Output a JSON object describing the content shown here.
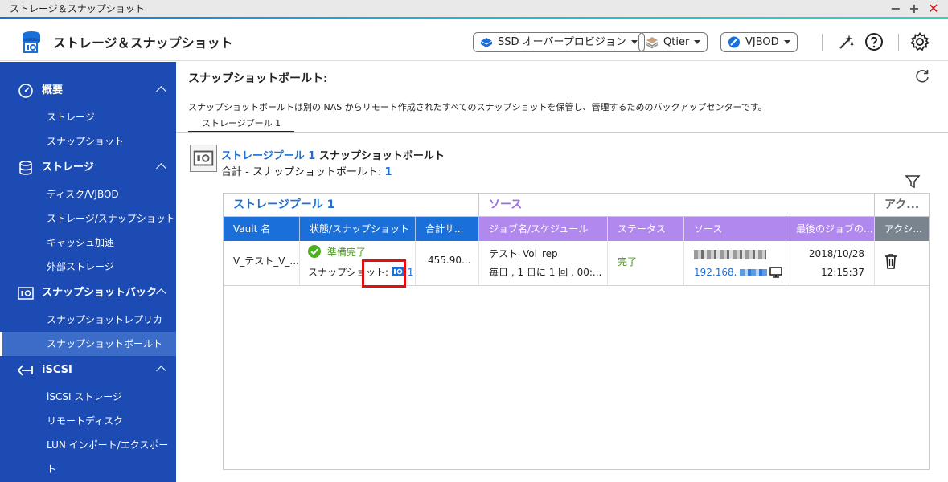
{
  "window": {
    "title": "ストレージ＆スナップショット",
    "minimize": "−",
    "maximize": "+",
    "close": "✕"
  },
  "header": {
    "app_title": "ストレージ＆スナップショット",
    "ssd_label": "SSD オーバープロビジョン",
    "qtier_label": "Qtier",
    "vjbod_label": "VJBOD",
    "icons": [
      "magic-wand-icon",
      "help-icon",
      "gear-icon"
    ]
  },
  "sidebar": {
    "groups": [
      {
        "label": "概要",
        "icon": "gauge-icon",
        "items": [
          "ストレージ",
          "スナップショット"
        ]
      },
      {
        "label": "ストレージ",
        "icon": "database-icon",
        "items": [
          "ディスク/VJBOD",
          "ストレージ/スナップショット",
          "キャッシュ加速",
          "外部ストレージ"
        ]
      },
      {
        "label": "スナップショットバックアップ",
        "icon": "snapshot-icon",
        "items": [
          "スナップショットレプリカ",
          "スナップショットボールト"
        ]
      },
      {
        "label": "iSCSI",
        "icon": "iscsi-icon",
        "items": [
          "iSCSI ストレージ",
          "リモートディスク",
          "LUN インポート/エクスポート"
        ]
      }
    ],
    "active_item": "スナップショットボールト"
  },
  "main": {
    "page_title": "スナップショットボールト:",
    "description": "スナップショットボールトは別の NAS からリモート作成されたすべてのスナップショットを保管し、管理するためのバックアップセンターです。",
    "tab": "ストレージプール 1",
    "vault_pool": "ストレージプール 1",
    "vault_suffix": " スナップショットボールト",
    "vault_total_label": "合計 - スナップショットボールト: ",
    "vault_total": "1"
  },
  "table": {
    "groups": [
      {
        "label": "ストレージプール 1"
      },
      {
        "label": "ソース"
      },
      {
        "label": "アク..."
      }
    ],
    "columns": [
      "Vault 名",
      "状態/スナップショット",
      "合計サ...",
      "ジョブ名/スケジュール",
      "ステータス",
      "ソース",
      "最後のジョブの...",
      "アクシ..."
    ],
    "rows": [
      {
        "vault_name": "V_テスト_V_...",
        "state": "準備完了",
        "snapshot_label": "スナップショット: ",
        "snapshot_count": "1",
        "total_size": "455.90...",
        "job_name": "テスト_Vol_rep",
        "schedule": "毎日 , 1 日に 1 回 , 00:...",
        "status": "完了",
        "source_ip": "192.168.",
        "last_date": "2018/10/28",
        "last_time": "12:15:37"
      }
    ]
  },
  "colors": {
    "sidebar": "#1c4cb3",
    "accent": "#1a6fd8",
    "purple": "#b088ee",
    "green": "#4a9a1a",
    "highlight": "#e01010"
  }
}
